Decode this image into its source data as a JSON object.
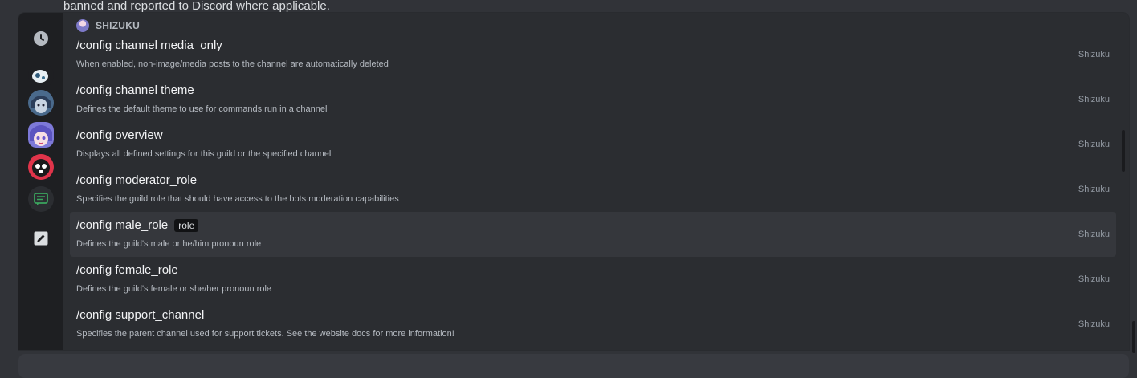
{
  "background": {
    "message_text": "banned and reported to Discord where applicable."
  },
  "rail": {
    "items": [
      {
        "name": "recent-icon"
      },
      {
        "name": "bot-avatar-1"
      },
      {
        "name": "bot-avatar-2"
      },
      {
        "name": "shizuku-avatar"
      },
      {
        "name": "bot-avatar-4"
      },
      {
        "name": "built-in-icon"
      },
      {
        "name": "edit-icon"
      }
    ]
  },
  "section": {
    "title": "SHIZUKU"
  },
  "commands": [
    {
      "name": "/config channel media_only",
      "option": "",
      "description": "When enabled, non-image/media posts to the channel are automatically deleted",
      "source": "Shizuku"
    },
    {
      "name": "/config channel theme",
      "option": "",
      "description": "Defines the default theme to use for commands run in a channel",
      "source": "Shizuku"
    },
    {
      "name": "/config overview",
      "option": "",
      "description": "Displays all defined settings for this guild or the specified channel",
      "source": "Shizuku"
    },
    {
      "name": "/config moderator_role",
      "option": "",
      "description": "Specifies the guild role that should have access to the bots moderation capabilities",
      "source": "Shizuku"
    },
    {
      "name": "/config male_role",
      "option": "role",
      "description": "Defines the guild's male or he/him pronoun role",
      "source": "Shizuku"
    },
    {
      "name": "/config female_role",
      "option": "",
      "description": "Defines the guild's female or she/her pronoun role",
      "source": "Shizuku"
    },
    {
      "name": "/config support_channel",
      "option": "",
      "description": "Specifies the parent channel used for support tickets. See the website docs for more information!",
      "source": "Shizuku"
    }
  ],
  "selected_index": 4,
  "colors": {
    "background": "#313338",
    "popup": "#2b2d31",
    "rail": "#1e1f22",
    "selected_row": "#35373c"
  }
}
